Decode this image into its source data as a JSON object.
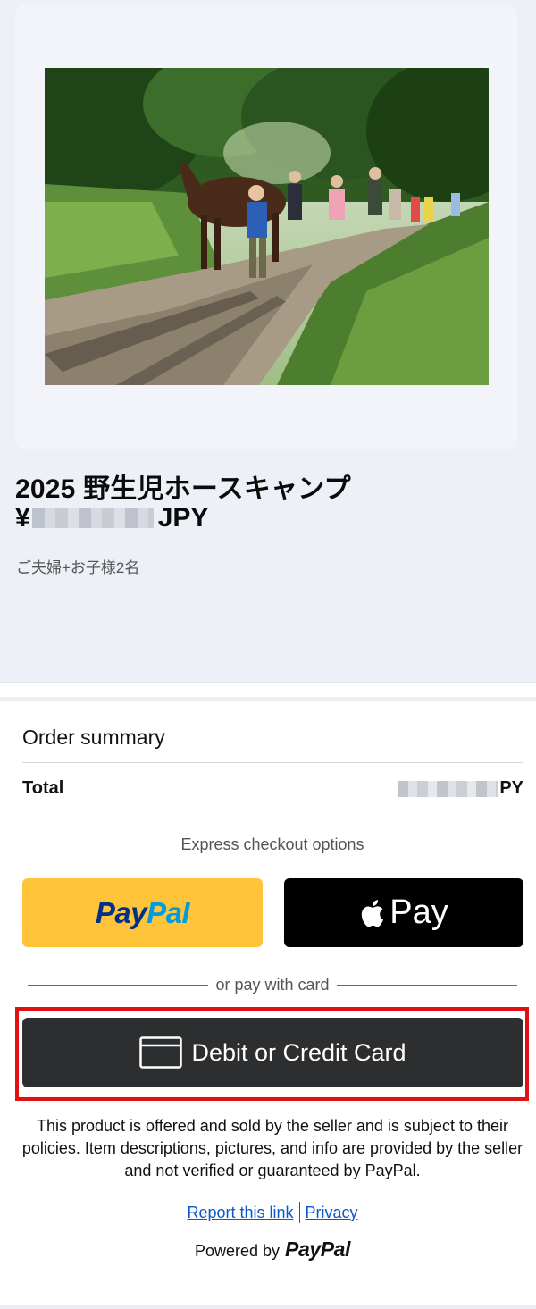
{
  "product": {
    "title": "2025 野生児ホースキャンプ",
    "price_prefix": "¥",
    "price_currency": "JPY",
    "description": "ご夫婦+お子様2名"
  },
  "order_summary": {
    "heading": "Order summary",
    "total_label": "Total",
    "total_currency_suffix": "PY"
  },
  "checkout": {
    "express_label": "Express checkout options",
    "paypal_logo_part1": "Pay",
    "paypal_logo_part2": "Pal",
    "applepay_label": "Pay",
    "or_text": "or pay with card",
    "card_button_label": "Debit or Credit Card"
  },
  "footer": {
    "disclaimer": "This product is offered and sold by the seller and is subject to their policies. Item descriptions, pictures, and info are provided by the seller and not verified or guaranteed by PayPal.",
    "report_link": "Report this link",
    "privacy_link": "Privacy",
    "powered_by": "Powered by",
    "powered_logo": "PayPal"
  },
  "colors": {
    "paypal_yellow": "#ffc439",
    "paypal_dark_blue": "#003087",
    "paypal_light_blue": "#009cde",
    "card_button": "#2c2e2f",
    "highlight": "#e11111",
    "link": "#0a58ca"
  },
  "icons": [
    "apple-icon",
    "credit-card-icon"
  ]
}
